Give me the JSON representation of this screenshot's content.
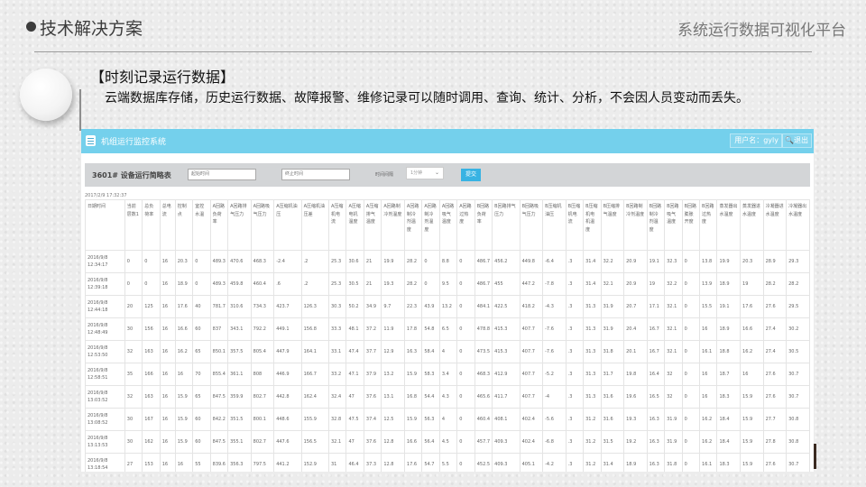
{
  "slide": {
    "title": "技术解决方案",
    "subtitle": "系统运行数据可视化平台",
    "section_heading": "【时刻记录运行数据】",
    "description": "云端数据库存储，历史运行数据、故障报警、维修记录可以随时调用、查询、统计、分析，不会因人员变动而丢失。"
  },
  "app": {
    "title": "机组运行监控系统",
    "user_label": "用户名：gyly",
    "logout_label": "退出",
    "filter": {
      "title": "3601# 设备运行简略表",
      "start_placeholder": "起始时间",
      "end_placeholder": "终止时间",
      "interval_label": "时间间隔",
      "interval_value": "1分钟",
      "submit_label": "提交"
    },
    "timestamp": "2017/2/9 17:32:37",
    "columns": [
      "日期时间",
      "当前层数1",
      "总负荷率",
      "总电流",
      "控制点",
      "室控水温",
      "A回路负荷率",
      "A回路排气压力",
      "A回路吸气压力",
      "A压缩机油压",
      "A压缩机油压差",
      "A压缩机电流",
      "A压缩电机温度",
      "A压缩排气温度",
      "A回路制冷剂温度",
      "A回路制冷剂温度",
      "A回路制冷剂温度",
      "A回路吸气温度",
      "A回路过热度",
      "B回路负荷率",
      "B回路排气压力",
      "B回路吸气压力",
      "B压缩机油压",
      "B压缩机电流",
      "B压缩机电机温度",
      "B压缩排气温度",
      "B回路制冷剂温度",
      "B回路制冷剂温度",
      "B回路吸气温度",
      "B回路膨胀开度",
      "B回路过热度",
      "蒸发器出水温度",
      "蒸发器进水温度",
      "冷凝器进水温度",
      "冷凝器出水温度"
    ],
    "rows": [
      [
        "2016/9/8 12:34:17",
        "0",
        "0",
        "16",
        "20.3",
        "0",
        "489.3",
        "470.6",
        "468.3",
        "-2.4",
        ".2",
        "25.3",
        "30.6",
        "21",
        "19.9",
        "28.2",
        "0",
        "8.8",
        "0",
        "486.7",
        "456.2",
        "449.8",
        "-6.4",
        ".3",
        "31.4",
        "32.2",
        "20.9",
        "19.1",
        "32.3",
        "0",
        "13.8",
        "19.9",
        "20.3",
        "28.9",
        "29.3"
      ],
      [
        "2016/9/8 12:39:18",
        "0",
        "0",
        "16",
        "18.9",
        "0",
        "489.3",
        "459.8",
        "460.4",
        ".6",
        ".2",
        "25.3",
        "30.5",
        "21",
        "19.3",
        "28.2",
        "0",
        "9.5",
        "0",
        "486.7",
        "455",
        "447.2",
        "-7.8",
        ".3",
        "31.4",
        "32.1",
        "20.9",
        "19",
        "32.2",
        "0",
        "13.9",
        "18.9",
        "19",
        "28.2",
        "28.2"
      ],
      [
        "2016/9/8 12:44:18",
        "20",
        "125",
        "16",
        "17.6",
        "40",
        "781.7",
        "310.6",
        "734.3",
        "423.7",
        "126.3",
        "30.3",
        "50.2",
        "34.9",
        "9.7",
        "22.3",
        "43.9",
        "13.2",
        "0",
        "484.1",
        "422.5",
        "418.2",
        "-4.3",
        ".3",
        "31.3",
        "31.9",
        "20.7",
        "17.1",
        "32.1",
        "0",
        "15.5",
        "19.1",
        "17.6",
        "27.6",
        "29.5"
      ],
      [
        "2016/9/8 12:48:49",
        "30",
        "156",
        "16",
        "16.6",
        "60",
        "837",
        "343.1",
        "792.2",
        "449.1",
        "156.8",
        "33.3",
        "48.1",
        "37.2",
        "11.9",
        "17.8",
        "54.8",
        "6.5",
        "0",
        "478.8",
        "415.3",
        "407.7",
        "-7.6",
        ".3",
        "31.3",
        "31.9",
        "20.4",
        "16.7",
        "32.1",
        "0",
        "16",
        "18.9",
        "16.6",
        "27.4",
        "30.2"
      ],
      [
        "2016/9/8 12:53:50",
        "32",
        "163",
        "16",
        "16.2",
        "65",
        "850.1",
        "357.5",
        "805.4",
        "447.9",
        "164.1",
        "33.1",
        "47.4",
        "37.7",
        "12.9",
        "16.3",
        "58.4",
        "4",
        "0",
        "473.5",
        "415.3",
        "407.7",
        "-7.6",
        ".3",
        "31.3",
        "31.8",
        "20.1",
        "16.7",
        "32.1",
        "0",
        "16.1",
        "18.8",
        "16.2",
        "27.4",
        "30.5"
      ],
      [
        "2016/9/8 12:58:51",
        "35",
        "166",
        "16",
        "16",
        "70",
        "855.4",
        "361.1",
        "808",
        "446.9",
        "166.7",
        "33.2",
        "47.1",
        "37.9",
        "13.2",
        "15.9",
        "58.3",
        "3.4",
        "0",
        "468.3",
        "412.9",
        "407.7",
        "-5.2",
        ".3",
        "31.3",
        "31.7",
        "19.8",
        "16.4",
        "32",
        "0",
        "16",
        "18.7",
        "16",
        "27.6",
        "30.7"
      ],
      [
        "2016/9/8 13:03:52",
        "32",
        "163",
        "16",
        "15.9",
        "65",
        "847.5",
        "359.9",
        "802.7",
        "442.8",
        "162.4",
        "32.4",
        "47",
        "37.6",
        "13.1",
        "16.8",
        "54.4",
        "4.3",
        "0",
        "465.6",
        "411.7",
        "407.7",
        "-4",
        ".3",
        "31.3",
        "31.6",
        "19.6",
        "16.5",
        "32",
        "0",
        "16",
        "18.3",
        "15.9",
        "27.6",
        "30.7"
      ],
      [
        "2016/9/8 13:08:52",
        "30",
        "167",
        "16",
        "15.9",
        "60",
        "842.2",
        "351.5",
        "800.1",
        "448.6",
        "155.9",
        "32.8",
        "47.5",
        "37.4",
        "12.5",
        "15.9",
        "56.3",
        "4",
        "0",
        "460.4",
        "408.1",
        "402.4",
        "-5.6",
        ".3",
        "31.2",
        "31.6",
        "19.3",
        "16.3",
        "31.9",
        "0",
        "16.2",
        "18.4",
        "15.9",
        "27.7",
        "30.8"
      ],
      [
        "2016/9/8 13:13:53",
        "30",
        "162",
        "16",
        "15.9",
        "60",
        "847.5",
        "355.1",
        "802.7",
        "447.6",
        "156.5",
        "32.1",
        "47",
        "37.6",
        "12.8",
        "16.6",
        "56.4",
        "4.5",
        "0",
        "457.7",
        "409.3",
        "402.4",
        "-6.8",
        ".3",
        "31.2",
        "31.5",
        "19.2",
        "16.3",
        "31.9",
        "0",
        "16.2",
        "18.4",
        "15.9",
        "27.8",
        "30.8"
      ],
      [
        "2016/9/8 13:18:54",
        "27",
        "153",
        "16",
        "16",
        "55",
        "839.6",
        "356.3",
        "797.5",
        "441.2",
        "152.9",
        "31",
        "46.4",
        "37.3",
        "12.8",
        "17.6",
        "54.7",
        "5.5",
        "0",
        "452.5",
        "409.3",
        "405.1",
        "-4.2",
        ".3",
        "31.2",
        "31.4",
        "18.9",
        "16.3",
        "31.8",
        "0",
        "16.1",
        "18.3",
        "15.9",
        "27.6",
        "30.7"
      ]
    ]
  }
}
